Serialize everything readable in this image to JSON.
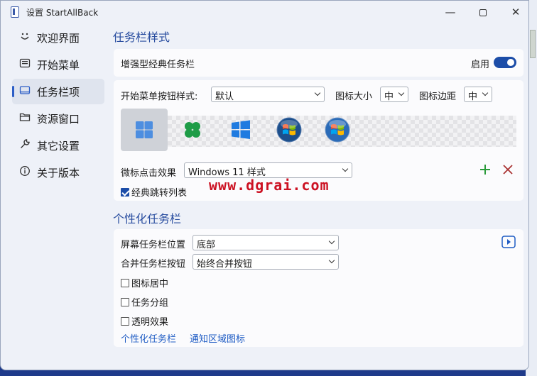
{
  "window": {
    "title": "设置 StartAllBack"
  },
  "nav": [
    {
      "label": "欢迎界面",
      "icon": "smile-icon"
    },
    {
      "label": "开始菜单",
      "icon": "start-menu-icon"
    },
    {
      "label": "任务栏项",
      "icon": "taskbar-icon",
      "active": true
    },
    {
      "label": "资源窗口",
      "icon": "folder-icon"
    },
    {
      "label": "其它设置",
      "icon": "wrench-icon"
    },
    {
      "label": "关于版本",
      "icon": "info-icon"
    }
  ],
  "taskbar_style": {
    "heading": "任务栏样式",
    "enhanced_label": "增强型经典任务栏",
    "enable_label": "启用",
    "enabled": true,
    "start_button_style_label": "开始菜单按钮样式:",
    "start_button_style_value": "默认",
    "icon_size_label": "图标大小",
    "icon_size_value": "中",
    "icon_margin_label": "图标边距",
    "icon_margin_value": "中",
    "start_buttons": [
      "win11-logo",
      "clover-logo",
      "win10-logo",
      "win7-orb",
      "win7-orb-alt"
    ],
    "click_effect_label": "微标点击效果",
    "click_effect_value": "Windows 11 样式",
    "classic_jumplist_label": "经典跳转列表",
    "classic_jumplist_checked": true
  },
  "personalize": {
    "heading": "个性化任务栏",
    "position_label": "屏幕任务栏位置",
    "position_value": "底部",
    "combine_label": "合并任务栏按钮",
    "combine_value": "始终合并按钮",
    "center_icons_label": "图标居中",
    "group_tasks_label": "任务分组",
    "transparent_label": "透明效果",
    "link_personalize": "个性化任务栏",
    "link_tray": "通知区域图标"
  },
  "watermark": "www.dgrai.com",
  "colors": {
    "accent": "#1c4da8",
    "heading": "#2a4ea0",
    "link": "#1f5cc4"
  }
}
